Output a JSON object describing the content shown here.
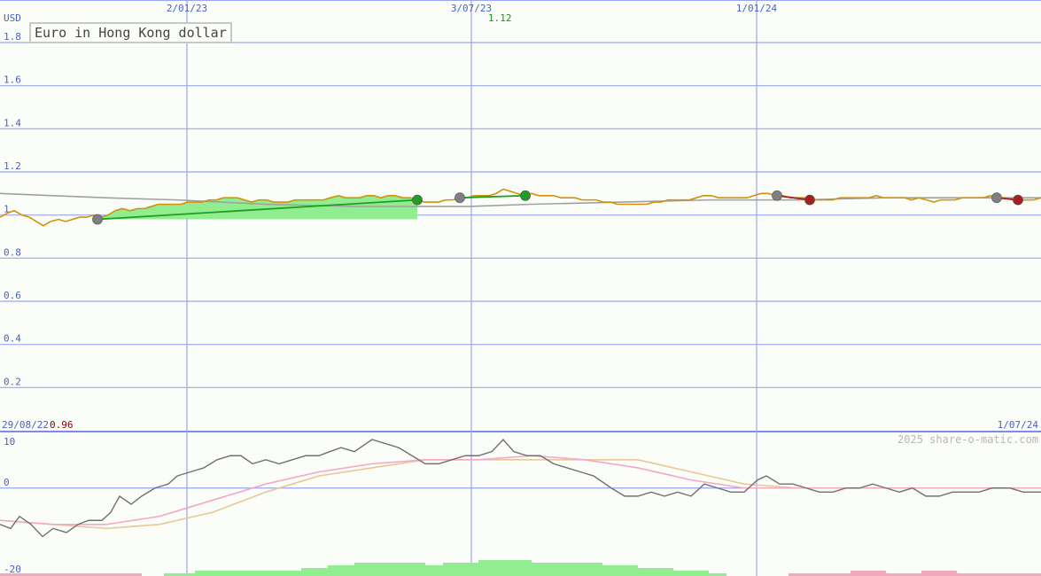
{
  "chart_data": {
    "type": "line",
    "title": "Euro in Hong Kong dollar",
    "unit": "USD",
    "copyright": "2025 share-o-matic.com",
    "x_ticks": [
      "2/01/23",
      "3/07/23",
      "1/01/24"
    ],
    "start_label": "29/08/22",
    "end_label": "1/07/24",
    "max_label": "1.12",
    "min_label": "0.96",
    "ylim": [
      0,
      1.8
    ],
    "y_ticks": [
      "1.8",
      "1.6",
      "1.4",
      "1.2",
      "1",
      "0.8",
      "0.6",
      "0.4",
      "0.2"
    ],
    "grid": true,
    "price": [
      [
        0,
        0.99
      ],
      [
        9,
        1.01
      ],
      [
        16,
        1.02
      ],
      [
        25,
        1.0
      ],
      [
        33,
        0.99
      ],
      [
        41,
        0.97
      ],
      [
        49,
        0.95
      ],
      [
        57,
        0.97
      ],
      [
        66,
        0.98
      ],
      [
        74,
        0.97
      ],
      [
        82,
        0.98
      ],
      [
        90,
        0.99
      ],
      [
        98,
        0.99
      ],
      [
        106,
        1.0
      ],
      [
        114,
        0.99
      ],
      [
        122,
        1.0
      ],
      [
        130,
        1.02
      ],
      [
        138,
        1.03
      ],
      [
        147,
        1.02
      ],
      [
        155,
        1.03
      ],
      [
        163,
        1.03
      ],
      [
        171,
        1.04
      ],
      [
        179,
        1.05
      ],
      [
        187,
        1.05
      ],
      [
        195,
        1.05
      ],
      [
        204,
        1.05
      ],
      [
        212,
        1.06
      ],
      [
        220,
        1.06
      ],
      [
        228,
        1.06
      ],
      [
        236,
        1.07
      ],
      [
        244,
        1.07
      ],
      [
        252,
        1.08
      ],
      [
        260,
        1.08
      ],
      [
        268,
        1.08
      ],
      [
        276,
        1.07
      ],
      [
        284,
        1.06
      ],
      [
        292,
        1.07
      ],
      [
        301,
        1.07
      ],
      [
        309,
        1.06
      ],
      [
        317,
        1.06
      ],
      [
        325,
        1.06
      ],
      [
        333,
        1.07
      ],
      [
        341,
        1.07
      ],
      [
        349,
        1.07
      ],
      [
        357,
        1.07
      ],
      [
        365,
        1.07
      ],
      [
        373,
        1.08
      ],
      [
        382,
        1.09
      ],
      [
        390,
        1.08
      ],
      [
        398,
        1.08
      ],
      [
        406,
        1.08
      ],
      [
        414,
        1.09
      ],
      [
        422,
        1.09
      ],
      [
        430,
        1.08
      ],
      [
        438,
        1.09
      ],
      [
        446,
        1.09
      ],
      [
        455,
        1.08
      ],
      [
        463,
        1.08
      ],
      [
        471,
        1.07
      ],
      [
        479,
        1.06
      ],
      [
        487,
        1.06
      ],
      [
        495,
        1.06
      ],
      [
        503,
        1.07
      ],
      [
        511,
        1.07
      ],
      [
        519,
        1.08
      ],
      [
        527,
        1.08
      ],
      [
        535,
        1.09
      ],
      [
        544,
        1.09
      ],
      [
        552,
        1.09
      ],
      [
        560,
        1.1
      ],
      [
        568,
        1.12
      ],
      [
        576,
        1.11
      ],
      [
        584,
        1.1
      ],
      [
        592,
        1.09
      ],
      [
        600,
        1.1
      ],
      [
        608,
        1.09
      ],
      [
        617,
        1.09
      ],
      [
        625,
        1.09
      ],
      [
        633,
        1.08
      ],
      [
        641,
        1.08
      ],
      [
        649,
        1.08
      ],
      [
        657,
        1.07
      ],
      [
        665,
        1.07
      ],
      [
        673,
        1.07
      ],
      [
        681,
        1.06
      ],
      [
        689,
        1.06
      ],
      [
        697,
        1.05
      ],
      [
        705,
        1.05
      ],
      [
        714,
        1.05
      ],
      [
        722,
        1.05
      ],
      [
        730,
        1.05
      ],
      [
        738,
        1.06
      ],
      [
        746,
        1.06
      ],
      [
        754,
        1.07
      ],
      [
        762,
        1.07
      ],
      [
        770,
        1.07
      ],
      [
        778,
        1.07
      ],
      [
        786,
        1.08
      ],
      [
        794,
        1.09
      ],
      [
        803,
        1.09
      ],
      [
        811,
        1.08
      ],
      [
        819,
        1.08
      ],
      [
        827,
        1.08
      ],
      [
        835,
        1.08
      ],
      [
        843,
        1.08
      ],
      [
        851,
        1.09
      ],
      [
        859,
        1.1
      ],
      [
        867,
        1.1
      ],
      [
        875,
        1.09
      ],
      [
        884,
        1.09
      ],
      [
        892,
        1.08
      ],
      [
        900,
        1.08
      ],
      [
        908,
        1.08
      ],
      [
        916,
        1.07
      ],
      [
        924,
        1.07
      ],
      [
        932,
        1.07
      ],
      [
        940,
        1.07
      ],
      [
        948,
        1.08
      ],
      [
        956,
        1.08
      ],
      [
        964,
        1.08
      ],
      [
        973,
        1.08
      ],
      [
        981,
        1.08
      ],
      [
        989,
        1.09
      ],
      [
        997,
        1.08
      ],
      [
        1005,
        1.08
      ],
      [
        1013,
        1.08
      ],
      [
        1021,
        1.08
      ],
      [
        1029,
        1.07
      ],
      [
        1037,
        1.08
      ],
      [
        1046,
        1.07
      ],
      [
        1054,
        1.06
      ],
      [
        1062,
        1.07
      ],
      [
        1070,
        1.07
      ],
      [
        1078,
        1.07
      ],
      [
        1086,
        1.08
      ],
      [
        1094,
        1.08
      ],
      [
        1102,
        1.08
      ],
      [
        1110,
        1.08
      ],
      [
        1118,
        1.09
      ],
      [
        1126,
        1.08
      ],
      [
        1134,
        1.08
      ],
      [
        1143,
        1.07
      ],
      [
        1151,
        1.07
      ],
      [
        1159,
        1.07
      ],
      [
        1167,
        1.07
      ],
      [
        1175,
        1.08
      ]
    ],
    "long_average": [
      [
        0,
        1.1
      ],
      [
        60,
        1.09
      ],
      [
        120,
        1.08
      ],
      [
        200,
        1.07
      ],
      [
        300,
        1.05
      ],
      [
        400,
        1.04
      ],
      [
        480,
        1.04
      ],
      [
        530,
        1.04
      ],
      [
        600,
        1.05
      ],
      [
        700,
        1.06
      ],
      [
        800,
        1.07
      ],
      [
        900,
        1.07
      ],
      [
        1000,
        1.08
      ],
      [
        1100,
        1.08
      ],
      [
        1175,
        1.08
      ]
    ],
    "buy_fill": {
      "x": [
        110,
        471
      ],
      "y_top": [
        0.98,
        1.07
      ],
      "y_bottom": 0.98
    },
    "trades": [
      {
        "type": "buy",
        "x1": 110,
        "y1": 0.98,
        "x2": 471,
        "y2": 1.07
      },
      {
        "type": "buy",
        "x1": 519,
        "y1": 1.08,
        "x2": 593,
        "y2": 1.09
      },
      {
        "type": "sell",
        "x1": 877,
        "y1": 1.09,
        "x2": 914,
        "y2": 1.07
      },
      {
        "type": "sell",
        "x1": 1125,
        "y1": 1.08,
        "x2": 1149,
        "y2": 1.07
      }
    ],
    "indicator": {
      "y_ticks": [
        "10",
        "0",
        "-20"
      ],
      "ylim": [
        -20,
        12
      ],
      "momentum": [
        [
          0,
          -9
        ],
        [
          12,
          -10
        ],
        [
          22,
          -7
        ],
        [
          35,
          -9
        ],
        [
          48,
          -12
        ],
        [
          60,
          -10
        ],
        [
          75,
          -11
        ],
        [
          88,
          -9
        ],
        [
          100,
          -8
        ],
        [
          115,
          -8
        ],
        [
          125,
          -6
        ],
        [
          135,
          -2
        ],
        [
          148,
          -4
        ],
        [
          160,
          -2
        ],
        [
          175,
          0
        ],
        [
          190,
          1
        ],
        [
          200,
          3
        ],
        [
          215,
          4
        ],
        [
          230,
          5
        ],
        [
          245,
          7
        ],
        [
          260,
          8
        ],
        [
          272,
          8
        ],
        [
          285,
          6
        ],
        [
          300,
          7
        ],
        [
          315,
          6
        ],
        [
          330,
          7
        ],
        [
          345,
          8
        ],
        [
          360,
          8
        ],
        [
          372,
          9
        ],
        [
          385,
          10
        ],
        [
          400,
          9
        ],
        [
          420,
          12
        ],
        [
          435,
          11
        ],
        [
          450,
          10
        ],
        [
          465,
          8
        ],
        [
          480,
          6
        ],
        [
          495,
          6
        ],
        [
          510,
          7
        ],
        [
          525,
          8
        ],
        [
          540,
          8
        ],
        [
          555,
          9
        ],
        [
          568,
          12
        ],
        [
          580,
          9
        ],
        [
          595,
          8
        ],
        [
          610,
          8
        ],
        [
          625,
          6
        ],
        [
          640,
          5
        ],
        [
          655,
          4
        ],
        [
          670,
          3
        ],
        [
          690,
          0
        ],
        [
          705,
          -2
        ],
        [
          720,
          -2
        ],
        [
          735,
          -1
        ],
        [
          750,
          -2
        ],
        [
          765,
          -1
        ],
        [
          780,
          -2
        ],
        [
          795,
          1
        ],
        [
          810,
          0
        ],
        [
          825,
          -1
        ],
        [
          840,
          -1
        ],
        [
          855,
          2
        ],
        [
          865,
          3
        ],
        [
          880,
          1
        ],
        [
          895,
          1
        ],
        [
          910,
          0
        ],
        [
          925,
          -1
        ],
        [
          940,
          -1
        ],
        [
          955,
          0
        ],
        [
          970,
          0
        ],
        [
          985,
          1
        ],
        [
          1000,
          0
        ],
        [
          1015,
          -1
        ],
        [
          1030,
          0
        ],
        [
          1045,
          -2
        ],
        [
          1060,
          -2
        ],
        [
          1075,
          -1
        ],
        [
          1090,
          -1
        ],
        [
          1105,
          -1
        ],
        [
          1120,
          0
        ],
        [
          1140,
          0
        ],
        [
          1155,
          -1
        ],
        [
          1175,
          -1
        ]
      ],
      "fast_average": [
        [
          0,
          -8
        ],
        [
          60,
          -9
        ],
        [
          120,
          -9
        ],
        [
          180,
          -7
        ],
        [
          240,
          -3
        ],
        [
          300,
          1
        ],
        [
          360,
          4
        ],
        [
          420,
          6
        ],
        [
          480,
          7
        ],
        [
          540,
          7
        ],
        [
          600,
          8
        ],
        [
          660,
          7
        ],
        [
          720,
          5
        ],
        [
          780,
          2
        ],
        [
          840,
          0
        ],
        [
          900,
          0
        ],
        [
          960,
          0
        ],
        [
          1020,
          0
        ],
        [
          1080,
          0
        ],
        [
          1175,
          0
        ]
      ],
      "slow_average": [
        [
          0,
          -8
        ],
        [
          60,
          -9
        ],
        [
          120,
          -10
        ],
        [
          180,
          -9
        ],
        [
          240,
          -6
        ],
        [
          300,
          -1
        ],
        [
          360,
          3
        ],
        [
          420,
          5
        ],
        [
          480,
          7
        ],
        [
          540,
          7
        ],
        [
          600,
          7
        ],
        [
          660,
          7
        ],
        [
          720,
          7
        ],
        [
          780,
          4
        ],
        [
          840,
          1
        ],
        [
          900,
          0
        ],
        [
          960,
          0
        ],
        [
          1020,
          0
        ],
        [
          1080,
          0
        ],
        [
          1175,
          0
        ]
      ],
      "histogram": [
        [
          0,
          -1
        ],
        [
          40,
          -1
        ],
        [
          80,
          -1
        ],
        [
          120,
          -1
        ],
        [
          160,
          0
        ],
        [
          185,
          1
        ],
        [
          220,
          2
        ],
        [
          260,
          2
        ],
        [
          300,
          2
        ],
        [
          340,
          3
        ],
        [
          370,
          4
        ],
        [
          400,
          5
        ],
        [
          440,
          5
        ],
        [
          480,
          4
        ],
        [
          500,
          5
        ],
        [
          540,
          6
        ],
        [
          570,
          6
        ],
        [
          600,
          5
        ],
        [
          640,
          5
        ],
        [
          680,
          4
        ],
        [
          720,
          3
        ],
        [
          760,
          2
        ],
        [
          800,
          1
        ],
        [
          820,
          0
        ],
        [
          860,
          0
        ],
        [
          890,
          -1
        ],
        [
          920,
          -1
        ],
        [
          960,
          -2
        ],
        [
          1000,
          -1
        ],
        [
          1040,
          -2
        ],
        [
          1080,
          -1
        ],
        [
          1120,
          -1
        ],
        [
          1160,
          -1
        ],
        [
          1175,
          -1
        ]
      ]
    }
  }
}
